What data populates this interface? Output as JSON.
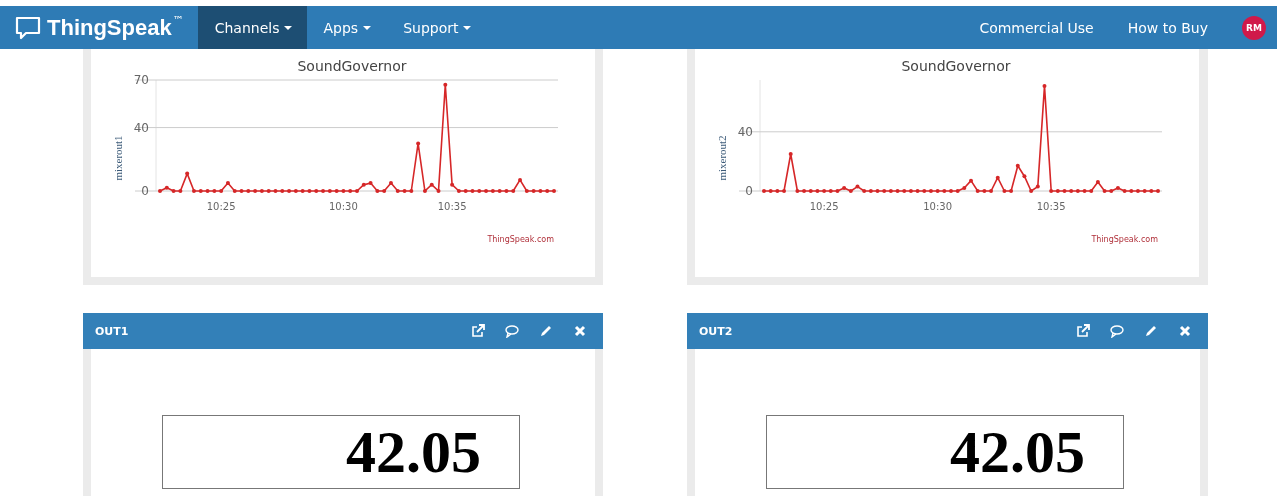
{
  "nav": {
    "brand": "ThingSpeak",
    "trademark": "™",
    "menus": [
      {
        "label": "Channels",
        "selected": true
      },
      {
        "label": "Apps",
        "selected": false
      },
      {
        "label": "Support",
        "selected": false
      }
    ],
    "links": [
      "Commercial Use",
      "How to Buy"
    ],
    "avatar": "RM"
  },
  "charts": [
    {
      "credit": "ThingSpeak.com",
      "chart_data": {
        "type": "line",
        "title": "SoundGovernor",
        "ylabel": "mixerout1",
        "ylim": [
          0,
          70
        ],
        "yticks": [
          0,
          40,
          70
        ],
        "categories": [
          null,
          null,
          null,
          null,
          null,
          null,
          null,
          null,
          null,
          "10:25",
          null,
          null,
          null,
          null,
          null,
          null,
          null,
          null,
          null,
          null,
          null,
          null,
          null,
          null,
          null,
          null,
          null,
          "10:30",
          null,
          null,
          null,
          null,
          null,
          null,
          null,
          null,
          null,
          null,
          null,
          null,
          null,
          null,
          null,
          "10:35",
          null,
          null,
          null,
          null,
          null,
          null,
          null,
          null,
          null,
          null,
          null,
          null,
          null,
          null,
          null
        ],
        "series": [
          {
            "color": "#d62728",
            "values": [
              0,
              2,
              0,
              0,
              11,
              0,
              0,
              0,
              0,
              0,
              5,
              0,
              0,
              0,
              0,
              0,
              0,
              0,
              0,
              0,
              0,
              0,
              0,
              0,
              0,
              0,
              0,
              0,
              0,
              0,
              4,
              5,
              0,
              0,
              5,
              0,
              0,
              0,
              30,
              0,
              4,
              0,
              67,
              4,
              0,
              0,
              0,
              0,
              0,
              0,
              0,
              0,
              0,
              7,
              0,
              0,
              0,
              0,
              0
            ]
          }
        ]
      }
    },
    {
      "credit": "ThingSpeak.com",
      "chart_data": {
        "type": "line",
        "title": "SoundGovernor",
        "ylabel": "mixerout2",
        "ylim": [
          0,
          75
        ],
        "yticks": [
          0,
          40
        ],
        "categories": [
          null,
          null,
          null,
          null,
          null,
          null,
          null,
          null,
          null,
          "10:25",
          null,
          null,
          null,
          null,
          null,
          null,
          null,
          null,
          null,
          null,
          null,
          null,
          null,
          null,
          null,
          null,
          "10:30",
          null,
          null,
          null,
          null,
          null,
          null,
          null,
          null,
          null,
          null,
          null,
          null,
          null,
          null,
          null,
          null,
          "10:35",
          null,
          null,
          null,
          null,
          null,
          null,
          null,
          null,
          null,
          null,
          null,
          null,
          null,
          null,
          null,
          null
        ],
        "series": [
          {
            "color": "#d62728",
            "values": [
              0,
              0,
              0,
              0,
              25,
              0,
              0,
              0,
              0,
              0,
              0,
              0,
              2,
              0,
              3,
              0,
              0,
              0,
              0,
              0,
              0,
              0,
              0,
              0,
              0,
              0,
              0,
              0,
              0,
              0,
              2,
              7,
              0,
              0,
              0,
              9,
              0,
              0,
              17,
              10,
              0,
              3,
              71,
              0,
              0,
              0,
              0,
              0,
              0,
              0,
              6,
              0,
              0,
              2,
              0,
              0,
              0,
              0,
              0,
              0
            ]
          }
        ]
      }
    }
  ],
  "widgets": [
    {
      "title": "OUT1",
      "value": "42.05"
    },
    {
      "title": "OUT2",
      "value": "42.05"
    }
  ]
}
